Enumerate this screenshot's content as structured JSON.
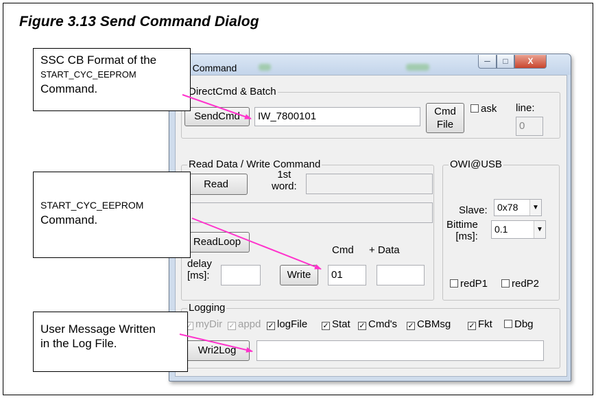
{
  "figure": {
    "title": "Figure 3.13 Send Command Dialog"
  },
  "dialog": {
    "title": "d Command",
    "window_controls": {
      "minimize": "─",
      "maximize": "□",
      "close": "X"
    },
    "direct_cmd": {
      "legend": "DirectCmd & Batch",
      "send_button": "SendCmd",
      "command_value": "IW_7800101",
      "cmd_file_button_line1": "Cmd",
      "cmd_file_button_line2": "File",
      "ask_label": "ask",
      "line_label": "line:",
      "line_value": "0"
    },
    "read_write": {
      "legend": "Read Data / Write Command",
      "read_button": "Read",
      "first_word_label_line1": "1st",
      "first_word_label_line2": "word:",
      "first_word_value": "",
      "read_output_value": "",
      "readloop_button": "ReadLoop",
      "cmd_label": "Cmd",
      "data_label": "+  Data",
      "delay_label_line1": "delay",
      "delay_label_line2": "[ms]:",
      "delay_value": "",
      "write_button": "Write",
      "cmd_value": "01",
      "data_value": ""
    },
    "owi": {
      "legend": "OWI@USB",
      "slave_label": "Slave:",
      "slave_value": "0x78",
      "bittime_label_line1": "Bittime",
      "bittime_label_line2": "[ms]:",
      "bittime_value": "0.1",
      "redp1_label": "redP1",
      "redp2_label": "redP2"
    },
    "logging": {
      "legend": "Logging",
      "options": [
        {
          "label": "myDir",
          "checked": true,
          "enabled": false
        },
        {
          "label": "appd",
          "checked": true,
          "enabled": false
        },
        {
          "label": "logFile",
          "checked": true,
          "enabled": true
        },
        {
          "label": "Stat",
          "checked": true,
          "enabled": true
        },
        {
          "label": "Cmd's",
          "checked": true,
          "enabled": true
        },
        {
          "label": "CBMsg",
          "checked": true,
          "enabled": true
        },
        {
          "label": "Fkt",
          "checked": true,
          "enabled": true
        },
        {
          "label": "Dbg",
          "checked": false,
          "enabled": true
        }
      ],
      "wri2log_button": "Wri2Log",
      "message_value": ""
    }
  },
  "callouts": {
    "top": {
      "line1": "SSC CB Format of the",
      "line2": "START_CYC_EEPROM",
      "line3": "Command."
    },
    "middle": {
      "line1": "START_CYC_EEPROM",
      "line2": "Command."
    },
    "bottom": {
      "line1": "User Message Written",
      "line2": "in the Log File."
    }
  },
  "colors": {
    "arrow": "#ff33cc",
    "close_button": "#c9452d",
    "dialog_frame": "#cfdcec"
  }
}
